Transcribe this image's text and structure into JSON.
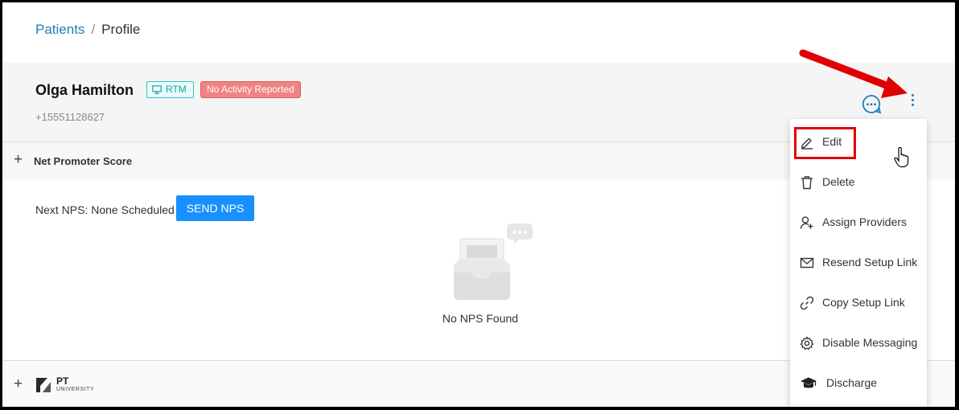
{
  "breadcrumb": {
    "parent": "Patients",
    "separator": "/",
    "current": "Profile"
  },
  "patient": {
    "name": "Olga Hamilton",
    "tag_rtm": "RTM",
    "tag_status": "No Activity Reported",
    "phone": "+15551128627"
  },
  "nps": {
    "section_title": "Net Promoter Score",
    "next_label": "Next NPS: None Scheduled",
    "send_button": "SEND NPS",
    "empty_text": "No NPS Found"
  },
  "menu": {
    "items": [
      "Edit",
      "Delete",
      "Assign Providers",
      "Resend Setup Link",
      "Copy Setup Link",
      "Disable Messaging",
      "Discharge"
    ]
  },
  "footer": {
    "logo_pt": "PT",
    "logo_university": "UNIVERSITY"
  },
  "colors": {
    "link": "#1f7fb6",
    "primary_button": "#1890ff",
    "rtm_tag": "#36c3c3",
    "status_badge": "#f08383",
    "annotation": "#e00000"
  }
}
